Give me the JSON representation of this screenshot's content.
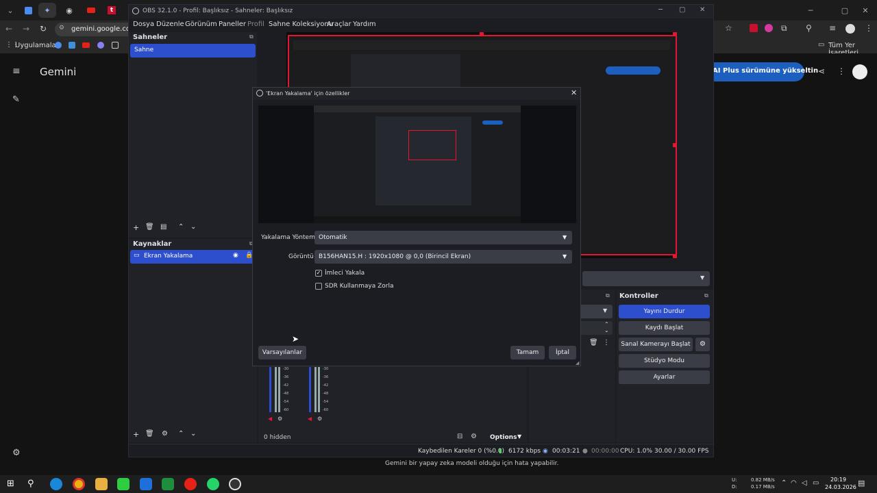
{
  "browser": {
    "url": "gemini.google.com/",
    "bookmarks_apps": "Uygulamalar",
    "bookmarks_all": "Tüm Yer İşaretleri"
  },
  "gemini": {
    "title": "Gemini",
    "upgrade_button": "AI Plus sürümüne yükseltin",
    "disclaimer": "Gemini bir yapay zeka modeli olduğu için hata yapabilir."
  },
  "obs": {
    "window_title": "OBS 32.1.0 - Profil: Başlıksız - Sahneler: Başlıksız",
    "menu": [
      "Dosya",
      "Düzenle",
      "Görünüm",
      "Paneller",
      "Profil",
      "Sahne Koleksiyonu",
      "Araçlar",
      "Yardım"
    ],
    "scenes_title": "Sahneler",
    "scene_item": "Sahne",
    "sources_title": "Kaynaklar",
    "source_item": "Ekran Yakalama",
    "controls_title": "Kontroller",
    "controls": {
      "stop_stream": "Yayını Durdur",
      "start_record": "Kaydı Başlat",
      "virtual_cam": "Sanal Kamerayı Başlat",
      "studio_mode": "Stüdyo Modu",
      "settings": "Ayarlar"
    },
    "mixer": {
      "hidden_label": "0 hidden",
      "options_label": "Options",
      "scale": [
        "-30",
        "-36",
        "-42",
        "-48",
        "-54",
        "-60"
      ]
    },
    "status": {
      "dropped_frames": "Kaybedilen Kareler 0 (%0.0)",
      "bitrate": "6172 kbps",
      "stream_time": "00:03:21",
      "record_time": "00:00:00",
      "cpu": "CPU: 1.0%",
      "fps": "30.00 / 30.00 FPS"
    }
  },
  "dialog": {
    "title": "'Ekran Yakalama' için özellikler",
    "capture_method_label": "Yakalama Yöntemi",
    "capture_method_value": "Otomatik",
    "display_label": "Görüntü",
    "display_value": "B156HAN15.H : 1920x1080 @ 0,0 (Birincil Ekran)",
    "capture_cursor_label": "İmleci Yakala",
    "capture_cursor_checked": true,
    "force_sdr_label": "SDR Kullanmaya Zorla",
    "force_sdr_checked": false,
    "defaults_button": "Varsayılanlar",
    "ok_button": "Tamam",
    "cancel_button": "İptal"
  },
  "taskbar": {
    "network_up": "0.82 MB/s",
    "network_down": "0.17 MB/s",
    "net_u": "U:",
    "net_d": "D:",
    "time": "20:19",
    "date": "24.03.2026"
  },
  "colors": {
    "accent": "#2d4fce",
    "record_red": "#e3182f",
    "obs_bg": "#1b1d23"
  }
}
